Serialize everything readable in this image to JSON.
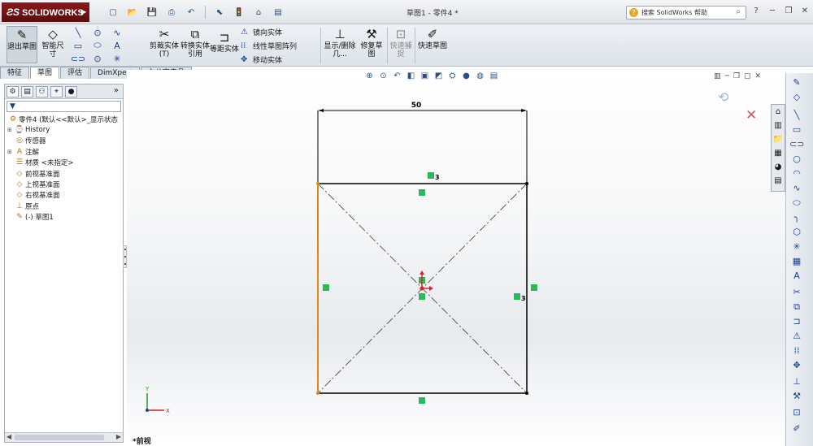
{
  "app": {
    "brand": "SOLIDWORKS",
    "window_title": "草图1 - 零件4 *",
    "help_search_placeholder": "搜索 SolidWorks 帮助"
  },
  "ribbon": {
    "exit_sketch": "退出草图",
    "smart_dimension": "智能尺寸",
    "trim_entities": "剪裁实体(T)",
    "convert_entities": "转换实体引用",
    "offset_entities": "等距实体",
    "mirror_entities": "镜向实体",
    "linear_pattern": "线性草图阵列",
    "move_entities": "移动实体",
    "display_delete_relations": "显示/删除几...",
    "repair_sketch": "修复草图",
    "quick_snaps": "快速捕捉",
    "rapid_sketch": "快速草图"
  },
  "command_tabs": [
    "特征",
    "草图",
    "评估",
    "DimXpert",
    "办公室产品"
  ],
  "active_tab": "草图",
  "feature_tree": {
    "root": "零件4 (默认<<默认>_显示状态",
    "items": [
      {
        "label": "History",
        "expandable": true,
        "icon": "history-icon"
      },
      {
        "label": "传感器",
        "expandable": false,
        "icon": "sensor-icon"
      },
      {
        "label": "注解",
        "expandable": true,
        "icon": "annotation-icon"
      },
      {
        "label": "材质 <未指定>",
        "expandable": false,
        "icon": "material-icon"
      },
      {
        "label": "前视基准面",
        "expandable": false,
        "icon": "plane-icon"
      },
      {
        "label": "上视基准面",
        "expandable": false,
        "icon": "plane-icon"
      },
      {
        "label": "右视基准面",
        "expandable": false,
        "icon": "plane-icon"
      },
      {
        "label": "原点",
        "expandable": false,
        "icon": "origin-icon"
      },
      {
        "label": "(-) 草图1",
        "expandable": false,
        "icon": "sketch-icon"
      }
    ]
  },
  "sketch": {
    "dimension": "50",
    "relation_tag": "3",
    "view_orientation": "*前视",
    "axis_y": "Y",
    "axis_x": "X"
  },
  "colors": {
    "line": "#000000",
    "selected_line": "#d98b1a",
    "relation": "#2eb85c",
    "origin": "#e02020"
  }
}
